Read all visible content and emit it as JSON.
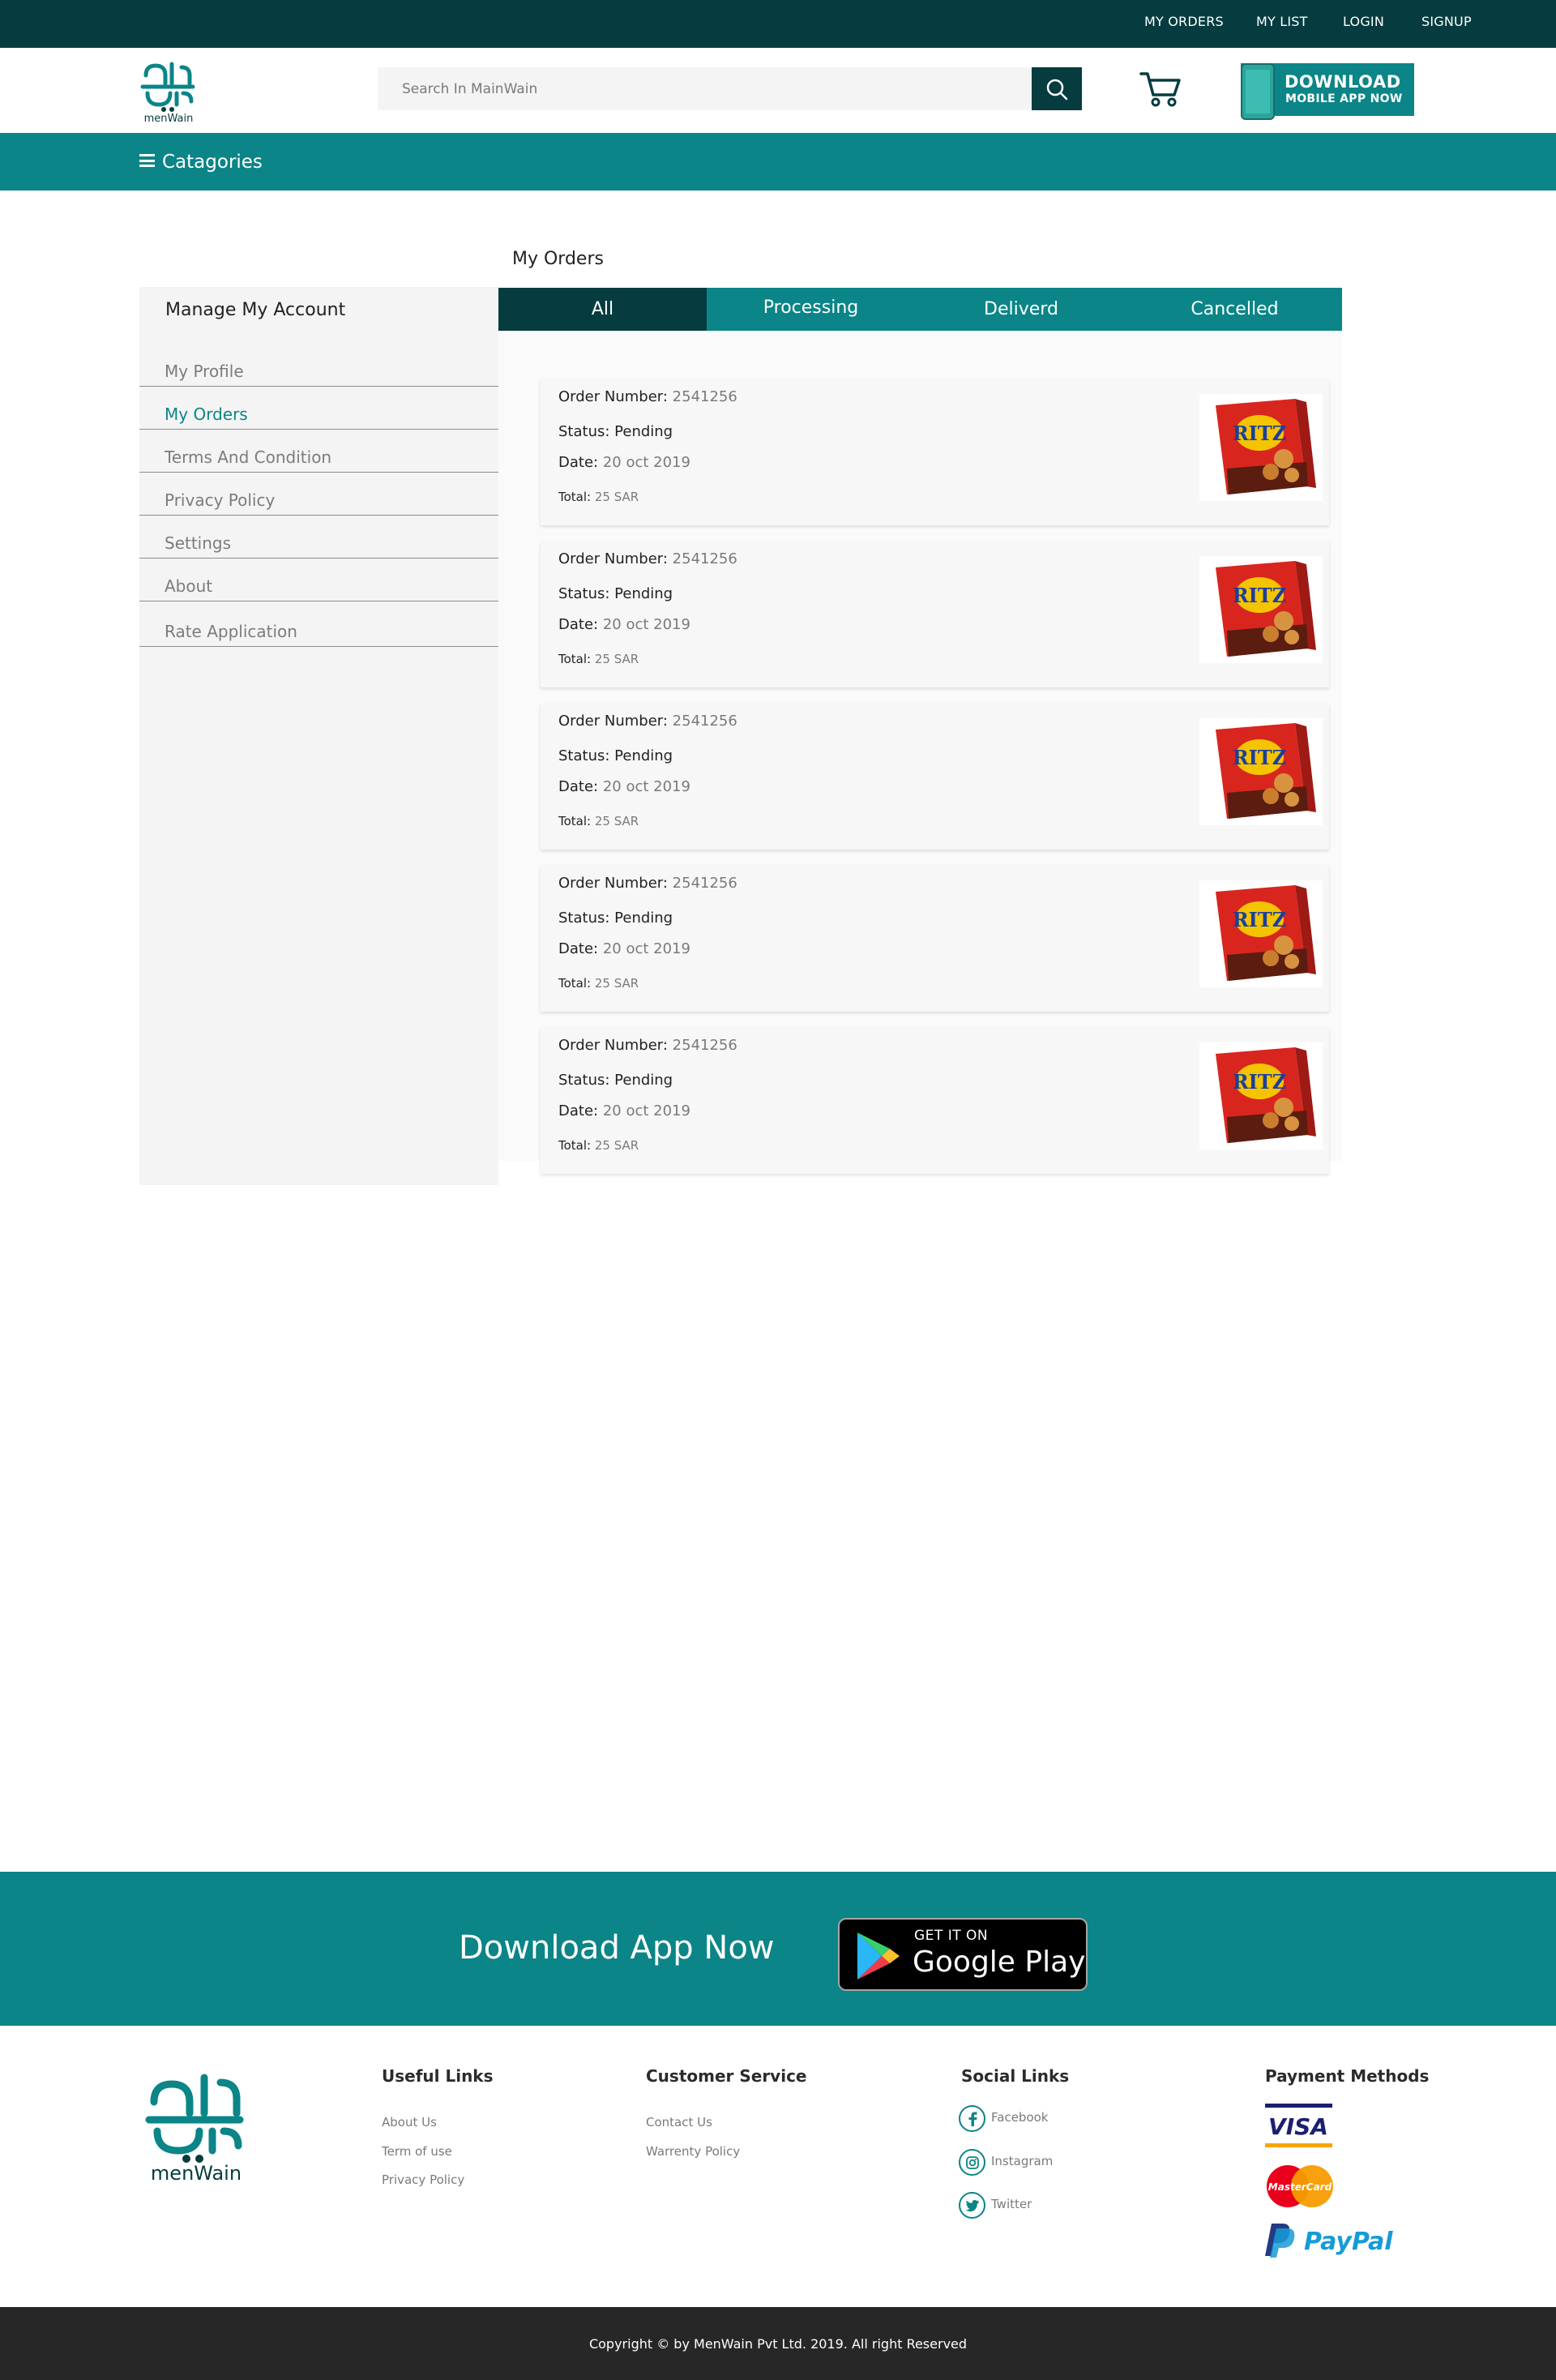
{
  "topnav": {
    "my_orders": "MY ORDERS",
    "my_list": "MY LIST",
    "login": "LOGIN",
    "signup": "SIGNUP"
  },
  "header": {
    "logo_text": "menWain",
    "search_placeholder": "Search In MainWain",
    "download_line1": "DOWNLOAD",
    "download_line2": "MOBILE APP NOW"
  },
  "catbar": {
    "label": "Catagories"
  },
  "page_title": "My Orders",
  "sidebar": {
    "heading": "Manage My Account",
    "items": [
      {
        "label": "My Profile",
        "active": false
      },
      {
        "label": "My Orders",
        "active": true
      },
      {
        "label": "Terms And Condition",
        "active": false
      },
      {
        "label": "Privacy Policy",
        "active": false
      },
      {
        "label": "Settings",
        "active": false
      },
      {
        "label": "About",
        "active": false
      },
      {
        "label": "Rate Application",
        "active": false
      }
    ]
  },
  "tabs": [
    {
      "label": "All",
      "active": true
    },
    {
      "label": "Processing",
      "active": false
    },
    {
      "label": "Deliverd",
      "active": false
    },
    {
      "label": "Cancelled",
      "active": false
    }
  ],
  "orders": [
    {
      "number_label": "Order Number:",
      "number": "2541256",
      "status_label": "Status:",
      "status": "Pending",
      "date_label": "Date:",
      "date": "20 oct 2019",
      "total_label": "Total:",
      "total": "25 SAR",
      "product_image": "RITZ"
    },
    {
      "number_label": "Order Number:",
      "number": "2541256",
      "status_label": "Status:",
      "status": "Pending",
      "date_label": "Date:",
      "date": "20 oct 2019",
      "total_label": "Total:",
      "total": "25 SAR",
      "product_image": "RITZ"
    },
    {
      "number_label": "Order Number:",
      "number": "2541256",
      "status_label": "Status:",
      "status": "Pending",
      "date_label": "Date:",
      "date": "20 oct 2019",
      "total_label": "Total:",
      "total": "25 SAR",
      "product_image": "RITZ"
    },
    {
      "number_label": "Order Number:",
      "number": "2541256",
      "status_label": "Status:",
      "status": "Pending",
      "date_label": "Date:",
      "date": "20 oct 2019",
      "total_label": "Total:",
      "total": "25 SAR",
      "product_image": "RITZ"
    },
    {
      "number_label": "Order Number:",
      "number": "2541256",
      "status_label": "Status:",
      "status": "Pending",
      "date_label": "Date:",
      "date": "20 oct 2019",
      "total_label": "Total:",
      "total": "25 SAR",
      "product_image": "RITZ"
    }
  ],
  "app_band": {
    "text": "Download App Now",
    "store_small": "GET IT ON",
    "store_big": "Google Play"
  },
  "footer": {
    "logo_text": "menWain",
    "useful_links": {
      "title": "Useful Links",
      "links": [
        "About Us",
        "Term of use",
        "Privacy Policy"
      ]
    },
    "customer_service": {
      "title": "Customer Service",
      "links": [
        "Contact Us",
        "Warrenty Policy"
      ]
    },
    "social_links": {
      "title": "Social Links",
      "links": [
        "Facebook",
        "Instagram",
        "Twitter"
      ]
    },
    "payment_methods": {
      "title": "Payment Methods",
      "visa": "VISA",
      "mastercard": "MasterCard",
      "paypal": "PayPal"
    }
  },
  "copyright": "Copyright © by MenWain Pvt Ltd. 2019. All right Reserved",
  "colors": {
    "dark_teal": "#063c3f",
    "teal": "#0b8587",
    "sidebar_bg": "#f4f4f4",
    "footer_dark": "#272727"
  },
  "icons": {
    "search": "search-icon",
    "cart": "cart-icon",
    "menu": "hamburger-icon",
    "facebook": "facebook-icon",
    "instagram": "instagram-icon",
    "twitter": "twitter-icon",
    "play": "google-play-icon"
  }
}
